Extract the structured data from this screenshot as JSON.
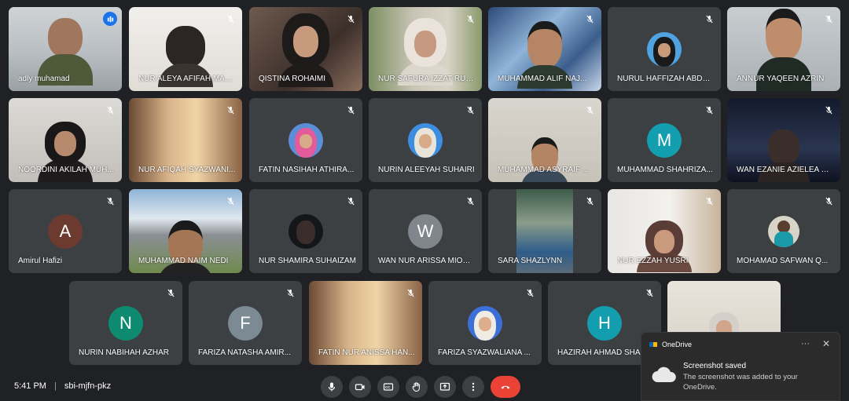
{
  "meeting": {
    "time": "5:41 PM",
    "code": "sbi-mjfn-pkz"
  },
  "participants": [
    {
      "name": "adly muhamad",
      "muted": false,
      "speaking": true
    },
    {
      "name": "NUR ALEYA AFIFAH MAZ...",
      "muted": true
    },
    {
      "name": "QISTINA ROHAIMI",
      "muted": true
    },
    {
      "name": "NUR SAFURA IZZAT RUS...",
      "muted": true
    },
    {
      "name": "MUHAMMAD ALIF NAJ...",
      "muted": true
    },
    {
      "name": "NURUL HAFFIZAH ABDU...",
      "muted": true
    },
    {
      "name": "ANNUR YAQEEN AZRIN",
      "muted": true
    },
    {
      "name": "NOORDINI AKILAH MUH...",
      "muted": true
    },
    {
      "name": "NUR AFIQAH SYAZWANI...",
      "muted": true
    },
    {
      "name": "FATIN NASIHAH ATHIRA...",
      "muted": true
    },
    {
      "name": "NURIN ALEEYAH SUHAIRI",
      "muted": true
    },
    {
      "name": "MUHAMMAD ASYRAIF ...",
      "muted": true
    },
    {
      "name": "MUHAMMAD SHAHRIZA...",
      "muted": true,
      "initial": "M",
      "color": "#129eaf"
    },
    {
      "name": "WAN EZANIE AZIELEA W...",
      "muted": true
    },
    {
      "name": "Amirul Hafizi",
      "muted": true,
      "initial": "A",
      "color": "#6d3a2f"
    },
    {
      "name": "MUHAMMAD NAIM NEDI",
      "muted": true
    },
    {
      "name": "NUR SHAMIRA SUHAIZAM",
      "muted": true
    },
    {
      "name": "WAN NUR ARISSA MIOR ...",
      "muted": true,
      "initial": "W",
      "color": "#80868b"
    },
    {
      "name": "SARA SHAZLYNN",
      "muted": true
    },
    {
      "name": "NUR EZZAH YUSRI",
      "muted": true
    },
    {
      "name": "MOHAMAD SAFWAN Q...",
      "muted": true
    },
    {
      "name": "NURIN NABIHAH AZHAR",
      "muted": true,
      "initial": "N",
      "color": "#0d8a6f"
    },
    {
      "name": "FARIZA NATASHA AMIR...",
      "muted": true,
      "initial": "F",
      "color": "#7b8a93"
    },
    {
      "name": "FATIN NUR ANISSA HAN...",
      "muted": true
    },
    {
      "name": "FARIZA SYAZWALIANA ...",
      "muted": true
    },
    {
      "name": "HAZIRAH AHMAD SHA...",
      "muted": true,
      "initial": "H",
      "color": "#129eaf"
    }
  ],
  "toast": {
    "app": "OneDrive",
    "title": "Screenshot saved",
    "body": "The screenshot was added to your OneDrive.",
    "more": "···",
    "close": "✕"
  },
  "controls": [
    "microphone",
    "camera",
    "captions",
    "raise-hand",
    "present",
    "more-options",
    "end-call"
  ],
  "colors": {
    "accent": "#8ab4f8",
    "end_call": "#ea4335",
    "tile": "#3c4043",
    "background": "#202124"
  }
}
